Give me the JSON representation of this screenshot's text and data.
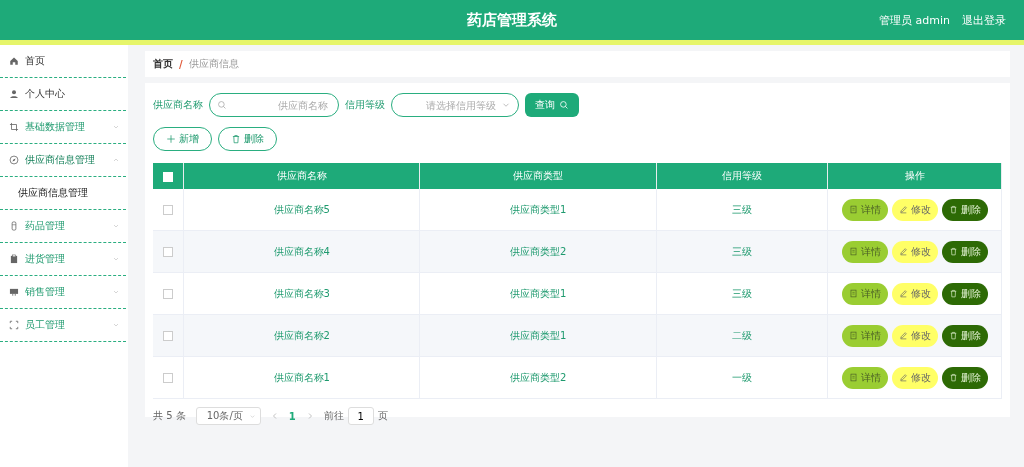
{
  "header": {
    "title": "药店管理系统",
    "user": "管理员 admin",
    "logout": "退出登录"
  },
  "sidebar": {
    "items": [
      {
        "label": "首页",
        "kind": "link"
      },
      {
        "label": "个人中心",
        "kind": "link"
      },
      {
        "label": "基础数据管理",
        "kind": "menu",
        "expanded": false
      },
      {
        "label": "供应商信息管理",
        "kind": "menu",
        "expanded": true,
        "children": [
          {
            "label": "供应商信息管理",
            "selected": true
          }
        ]
      },
      {
        "label": "药品管理",
        "kind": "menu",
        "expanded": false
      },
      {
        "label": "进货管理",
        "kind": "menu",
        "expanded": false
      },
      {
        "label": "销售管理",
        "kind": "menu",
        "expanded": false
      },
      {
        "label": "员工管理",
        "kind": "menu",
        "expanded": false
      }
    ]
  },
  "breadcrumb": {
    "items": [
      "首页",
      "供应商信息"
    ],
    "separator": "/"
  },
  "search": {
    "fields": [
      {
        "label": "供应商名称",
        "placeholder": "供应商名称",
        "kind": "text"
      },
      {
        "label": "信用等级",
        "placeholder": "请选择信用等级",
        "kind": "select"
      }
    ],
    "button": "查询"
  },
  "actions": [
    {
      "label": "新增",
      "kind": "add"
    },
    {
      "label": "删除",
      "kind": "delete"
    }
  ],
  "table": {
    "all_checked": false,
    "columns": [
      "供应商名称",
      "供应商类型",
      "信用等级",
      "操作"
    ],
    "rows": [
      {
        "name": "供应商名称5",
        "type": "供应商类型1",
        "level": "三级",
        "checked": false,
        "actions": [
          {
            "label": "详情",
            "kind": "detail"
          },
          {
            "label": "修改",
            "kind": "edit"
          },
          {
            "label": "删除",
            "kind": "delete"
          }
        ]
      },
      {
        "name": "供应商名称4",
        "type": "供应商类型2",
        "level": "三级",
        "checked": false,
        "actions": [
          {
            "label": "详情",
            "kind": "detail"
          },
          {
            "label": "修改",
            "kind": "edit"
          },
          {
            "label": "删除",
            "kind": "delete"
          }
        ]
      },
      {
        "name": "供应商名称3",
        "type": "供应商类型1",
        "level": "三级",
        "checked": false,
        "actions": [
          {
            "label": "详情",
            "kind": "detail"
          },
          {
            "label": "修改",
            "kind": "edit"
          },
          {
            "label": "删除",
            "kind": "delete"
          }
        ]
      },
      {
        "name": "供应商名称2",
        "type": "供应商类型1",
        "level": "二级",
        "checked": false,
        "actions": [
          {
            "label": "详情",
            "kind": "detail"
          },
          {
            "label": "修改",
            "kind": "edit"
          },
          {
            "label": "删除",
            "kind": "delete"
          }
        ]
      },
      {
        "name": "供应商名称1",
        "type": "供应商类型2",
        "level": "一级",
        "checked": false,
        "actions": [
          {
            "label": "详情",
            "kind": "detail"
          },
          {
            "label": "修改",
            "kind": "edit"
          },
          {
            "label": "删除",
            "kind": "delete"
          }
        ]
      }
    ]
  },
  "pagination": {
    "total": "共 5 条",
    "page_size": "10条/页",
    "pages": [
      {
        "label": "1",
        "selected": true
      }
    ],
    "goto_label": "前往",
    "goto_value": "1",
    "goto_suffix": "页"
  }
}
